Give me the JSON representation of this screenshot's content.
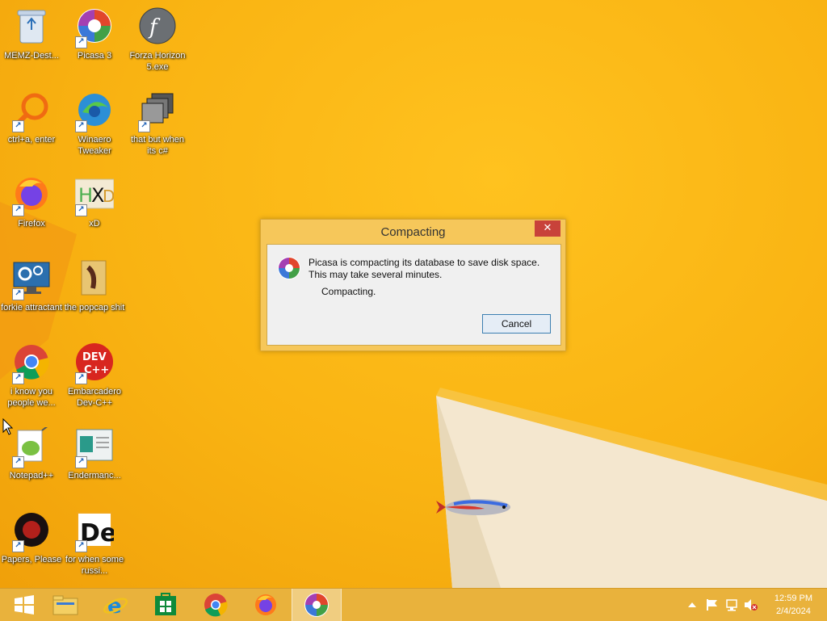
{
  "desktop": {
    "icons": [
      {
        "label": "MEMZ-Dest...",
        "icon": "recycle-bin-icon"
      },
      {
        "label": "Picasa 3",
        "icon": "picasa-icon"
      },
      {
        "label": "Forza Horizon 5.exe",
        "icon": "flash-icon"
      },
      {
        "label": "ctrl+a, enter",
        "icon": "magnifier-icon"
      },
      {
        "label": "Winaero Tweaker",
        "icon": "winaero-icon"
      },
      {
        "label": "that but when its c#",
        "icon": "windows-stack-icon"
      },
      {
        "label": "Firefox",
        "icon": "firefox-icon"
      },
      {
        "label": "xD",
        "icon": "hxd-icon"
      },
      {
        "label": "forkie attractant",
        "icon": "monitor-gear-icon"
      },
      {
        "label": "the popcap shit",
        "icon": "folder-icon"
      },
      {
        "label": "i know you people we...",
        "icon": "chrome-icon"
      },
      {
        "label": "Embarcadero Dev-C++",
        "icon": "devcpp-icon"
      },
      {
        "label": "Notepad++",
        "icon": "notepadpp-icon"
      },
      {
        "label": "Endermanc...",
        "icon": "app-window-icon"
      },
      {
        "label": "Papers, Please",
        "icon": "papers-please-icon"
      },
      {
        "label": "for when some russi...",
        "icon": "de-icon"
      }
    ]
  },
  "dialog": {
    "title": "Compacting",
    "close": "✕",
    "message_line1": "Picasa is compacting its database to save disk space.",
    "message_line2": "This may take several minutes.",
    "status": "Compacting.",
    "cancel_label": "Cancel"
  },
  "taskbar": {
    "apps": [
      "start-icon",
      "file-explorer-icon",
      "internet-explorer-icon",
      "store-icon",
      "chrome-icon",
      "firefox-icon",
      "picasa-icon"
    ],
    "clock": {
      "time": "12:59 PM",
      "date": "2/4/2024"
    }
  }
}
